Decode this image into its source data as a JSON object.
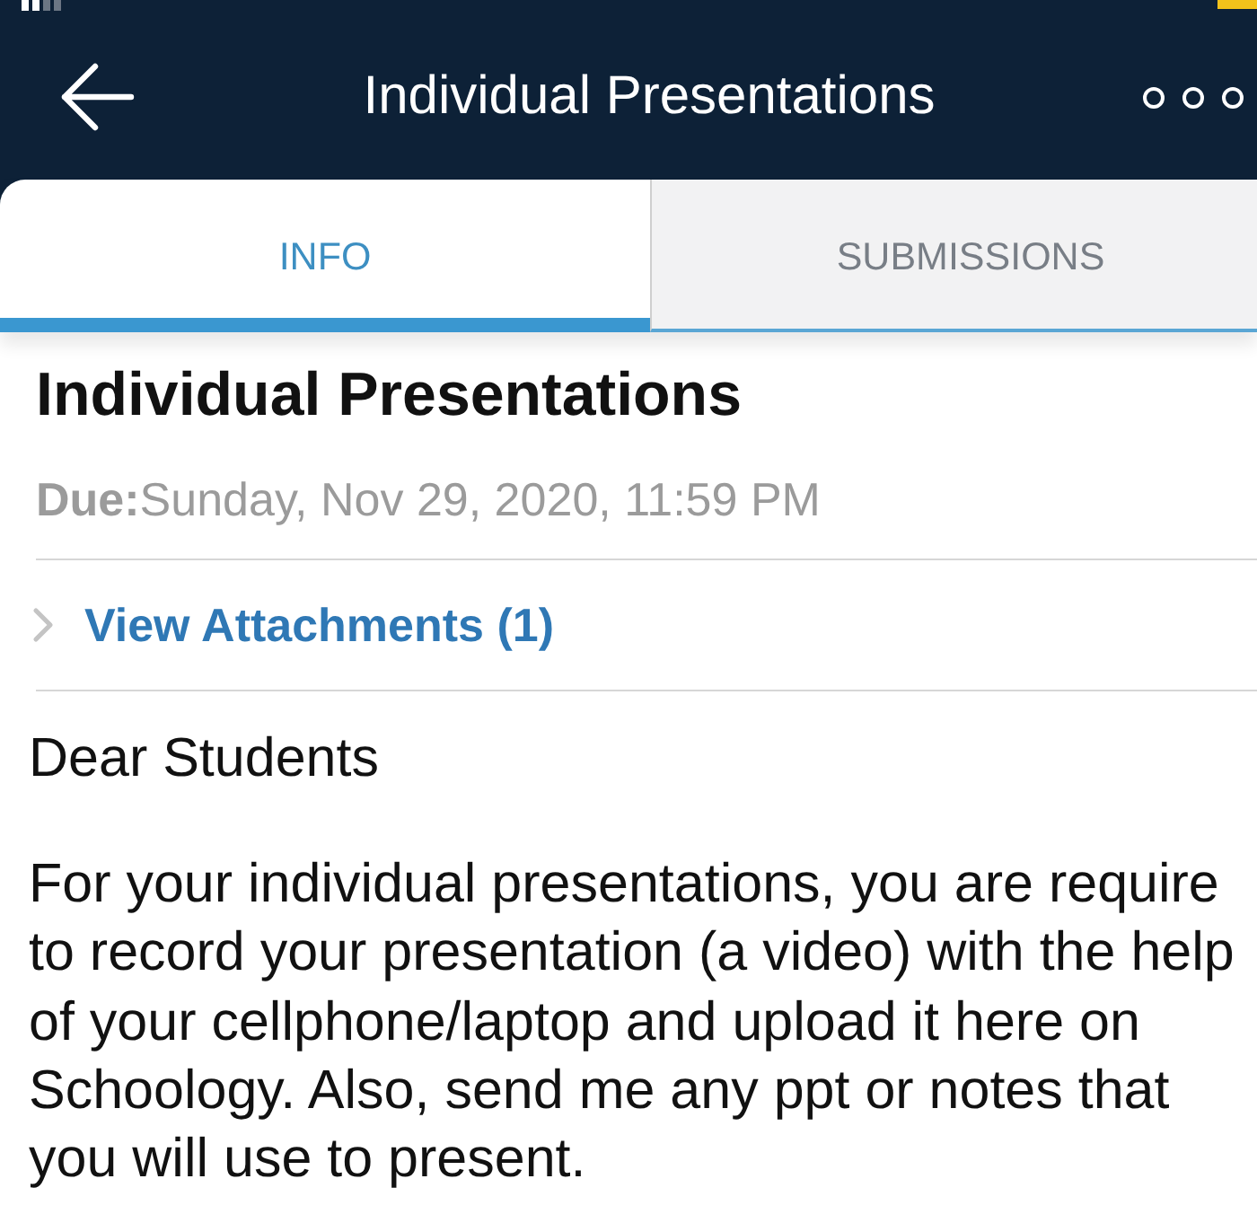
{
  "header": {
    "title": "Individual Presentations"
  },
  "tabs": [
    {
      "label": "INFO",
      "selected": true
    },
    {
      "label": "SUBMISSIONS",
      "selected": false
    }
  ],
  "assignment": {
    "title": "Individual Presentations",
    "due": "**Due:**Sunday, Nov 29, 2020, 11:59 PM",
    "attachments_link": "View Attachments (1)",
    "greeting": "Dear Students",
    "body": "For your individual presentations, you are require\nto record your presentation (a video) with the help\nof your cellphone/laptop and upload it here on\nSchoology. Also, send me any ppt or notes that\nyou will use to present."
  }
}
